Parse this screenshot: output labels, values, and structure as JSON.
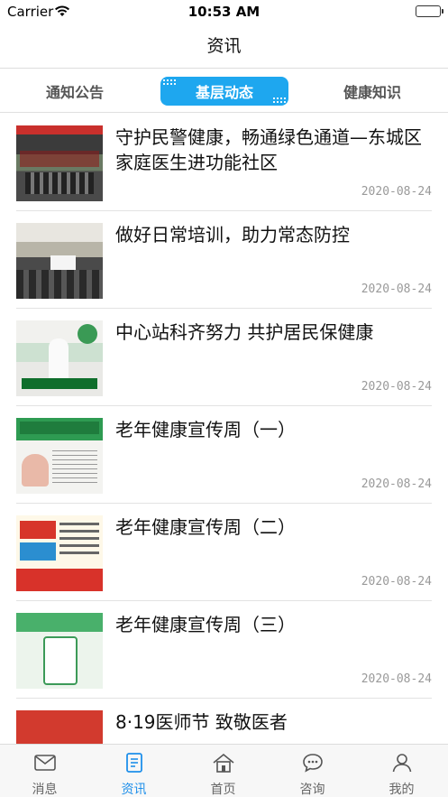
{
  "status_bar": {
    "carrier": "Carrier",
    "time": "10:53 AM"
  },
  "nav": {
    "title": "资讯"
  },
  "tabs": [
    {
      "label": "通知公告",
      "active": false
    },
    {
      "label": "基层动态",
      "active": true
    },
    {
      "label": "健康知识",
      "active": false
    }
  ],
  "colors": {
    "accent": "#1ea7ef",
    "active_tab_text": "#1e8fea",
    "date_text": "#999999"
  },
  "articles": [
    {
      "title": "守护民警健康，畅通绿色通道—东城区家庭医生进功能社区",
      "date": "2020-08-24"
    },
    {
      "title": "做好日常培训，助力常态防控",
      "date": "2020-08-24"
    },
    {
      "title": "中心站科齐努力 共护居民保健康",
      "date": "2020-08-24"
    },
    {
      "title": "老年健康宣传周（一）",
      "date": "2020-08-24"
    },
    {
      "title": "老年健康宣传周（二）",
      "date": "2020-08-24"
    },
    {
      "title": "老年健康宣传周（三）",
      "date": "2020-08-24"
    },
    {
      "title": "8·19医师节 致敬医者",
      "date": ""
    }
  ],
  "tab_bar": [
    {
      "label": "消息",
      "icon": "mail-icon",
      "active": false
    },
    {
      "label": "资讯",
      "icon": "news-icon",
      "active": true
    },
    {
      "label": "首页",
      "icon": "home-icon",
      "active": false
    },
    {
      "label": "咨询",
      "icon": "chat-icon",
      "active": false
    },
    {
      "label": "我的",
      "icon": "user-icon",
      "active": false
    }
  ]
}
